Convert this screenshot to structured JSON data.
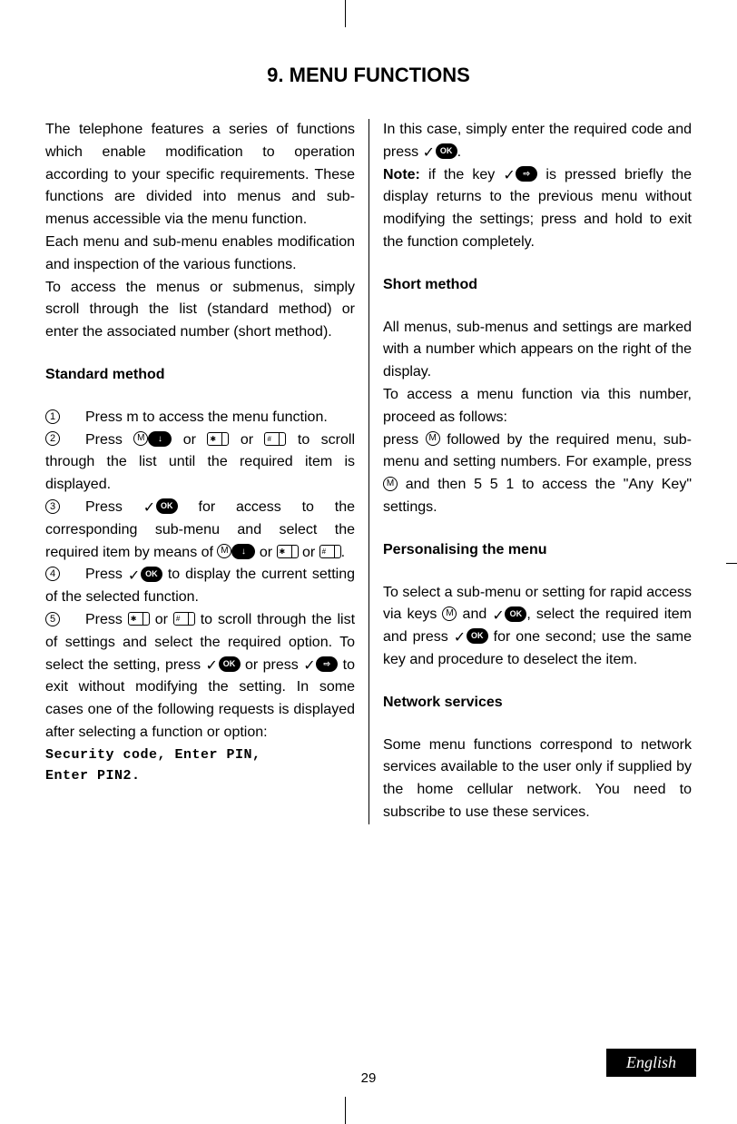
{
  "title": "9. MENU FUNCTIONS",
  "page_number": "29",
  "language_badge": "English",
  "icons": {
    "m": "M",
    "ok": "OK",
    "down": "↓",
    "back": "⇨"
  },
  "left": {
    "intro1": "The telephone features a series of functions which enable modification to operation according to your specific requirements. These functions are divided into menus and sub-menus accessible via the menu function.",
    "intro2": "Each menu and sub-menu enables modification and inspection of the various functions.",
    "intro3": "To access the menus or submenus, simply scroll through the list (standard method) or enter the associated number (short method).",
    "heading_standard": "Standard method",
    "step1_num": "1",
    "step1_a": "Press m to access the menu function.",
    "step2_num": "2",
    "step2_a": "Press ",
    "step2_b": " or ",
    "step2_c": " or ",
    "step2_d": " to scroll through the list until the required item is displayed.",
    "step3_num": "3",
    "step3_a": "Press ",
    "step3_b": " for access to the corresponding sub-menu and select the required item by means of ",
    "step3_c": " or ",
    "step3_d": " or ",
    "step3_e": ".",
    "step4_num": "4",
    "step4_a": "Press ",
    "step4_b": " to display the current setting of the selected function.",
    "step5_num": "5",
    "step5_a": "Press ",
    "step5_b": " or ",
    "step5_c": " to scroll through the list of settings and select the required option. To select the setting, press ",
    "step5_d": " or press ",
    "step5_e": " to exit without modifying the setting. In some cases one of the following requests is displayed after selecting a function or option:",
    "monoline1": "Security code, Enter PIN,",
    "monoline2": "Enter PIN2."
  },
  "right": {
    "top1": "In this case, simply enter the required code and press ",
    "top1b": ".",
    "note_label": "Note:",
    "note_a": " if the key ",
    "note_b": " is pressed briefly the display returns to the previous menu without modifying the settings; press and hold to exit the function completely.",
    "heading_short": "Short method",
    "short1": "All menus, sub-menus and settings are marked with a number which appears on the right of the display.",
    "short2": "To access a menu function via this number, proceed as follows:",
    "short3a": "press ",
    "short3b": " followed by the required menu, sub-menu and setting numbers. For example, press ",
    "short3c": " and then 5 5 1 to access the \"Any Key\" settings.",
    "heading_pers": "Personalising the menu",
    "pers_a": "To select a sub-menu or setting for rapid access via keys ",
    "pers_b": " and ",
    "pers_c": ", select the required item and press ",
    "pers_d": " for one second; use the same key and procedure to deselect the item.",
    "heading_net": "Network services",
    "net": "Some menu functions correspond to network services available to the user only if supplied by the home cellular network. You need to subscribe to use these services."
  }
}
